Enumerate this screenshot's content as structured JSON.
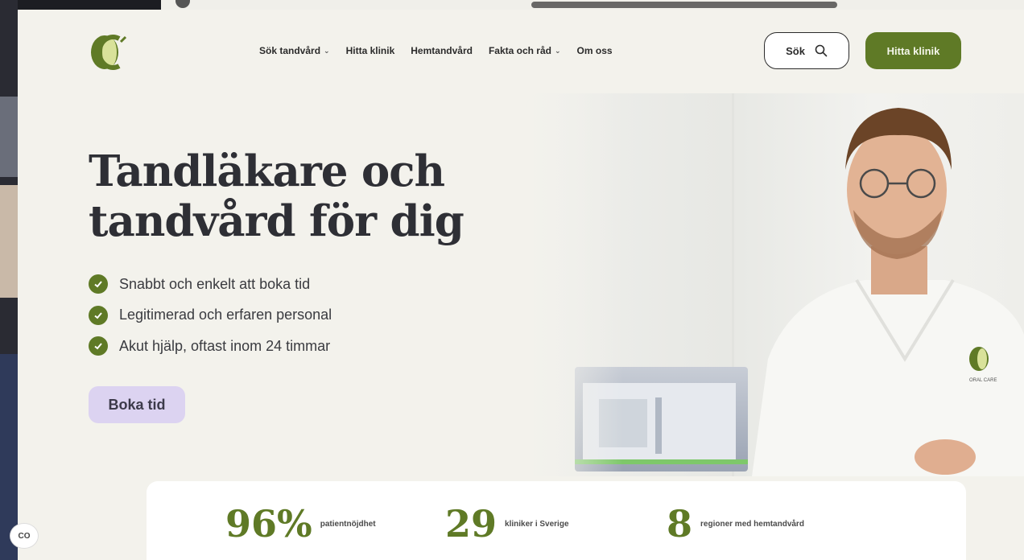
{
  "header": {
    "logo": "oral-care-logo",
    "nav": [
      {
        "label": "Sök tandvård",
        "has_dropdown": true
      },
      {
        "label": "Hitta klinik",
        "has_dropdown": false
      },
      {
        "label": "Hemtandvård",
        "has_dropdown": false
      },
      {
        "label": "Fakta och råd",
        "has_dropdown": true
      },
      {
        "label": "Om oss",
        "has_dropdown": false
      }
    ],
    "search_label": "Sök",
    "find_clinic_label": "Hitta klinik"
  },
  "hero": {
    "title_line1": "Tandläkare och",
    "title_line2": "tandvård för dig",
    "bullets": [
      "Snabbt och enkelt att boka tid",
      "Legitimerad och erfaren personal",
      "Akut hjälp, oftast inom 24 timmar"
    ],
    "cta_label": "Boka tid",
    "badge_text": "ORAL CARE"
  },
  "stats": [
    {
      "value": "96%",
      "label": "patientnöjdhet"
    },
    {
      "value": "29",
      "label": "kliniker i Sverige"
    },
    {
      "value": "8",
      "label": "regioner med hemtandvård"
    }
  ],
  "cookie_button_label": "CO",
  "colors": {
    "brand_green": "#5f7a26",
    "cta_lavender": "#dcd3f1",
    "page_bg": "#f3f2ec"
  }
}
